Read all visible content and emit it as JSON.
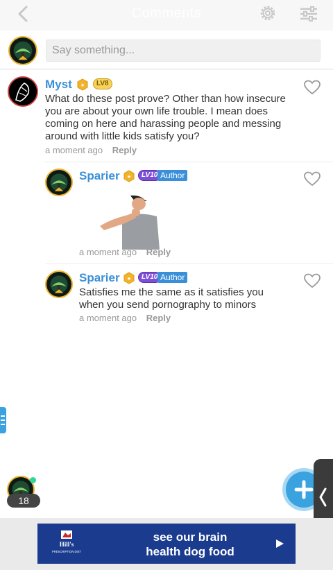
{
  "header": {
    "title": "Comments"
  },
  "compose": {
    "placeholder": "Say something..."
  },
  "comments": [
    {
      "author": "Myst",
      "level": "LV8",
      "text": "What do these post prove? Other than how insecure you are about your own life trouble. I mean does coming on here and harassing people and messing around with little kids satisfy you?",
      "time": "a moment ago",
      "reply_label": "Reply"
    },
    {
      "author": "Sparier",
      "level": "LV10",
      "author_tag": "Author",
      "time": "a moment ago",
      "reply_label": "Reply"
    },
    {
      "author": "Sparier",
      "level": "LV10",
      "author_tag": "Author",
      "text": "Satisfies me the same as it satisfies you when you send pornography to minors",
      "time": "a moment ago",
      "reply_label": "Reply"
    }
  ],
  "online": {
    "count": "18"
  },
  "ad": {
    "brand": "Hill's",
    "brand_sub": "PRESCRIPTION DIET",
    "line1": "see our brain",
    "line2": "health dog food"
  },
  "colors": {
    "accent": "#3a8fd9",
    "fab": "#3aa3df",
    "ad_bg": "#1b3b8f"
  }
}
